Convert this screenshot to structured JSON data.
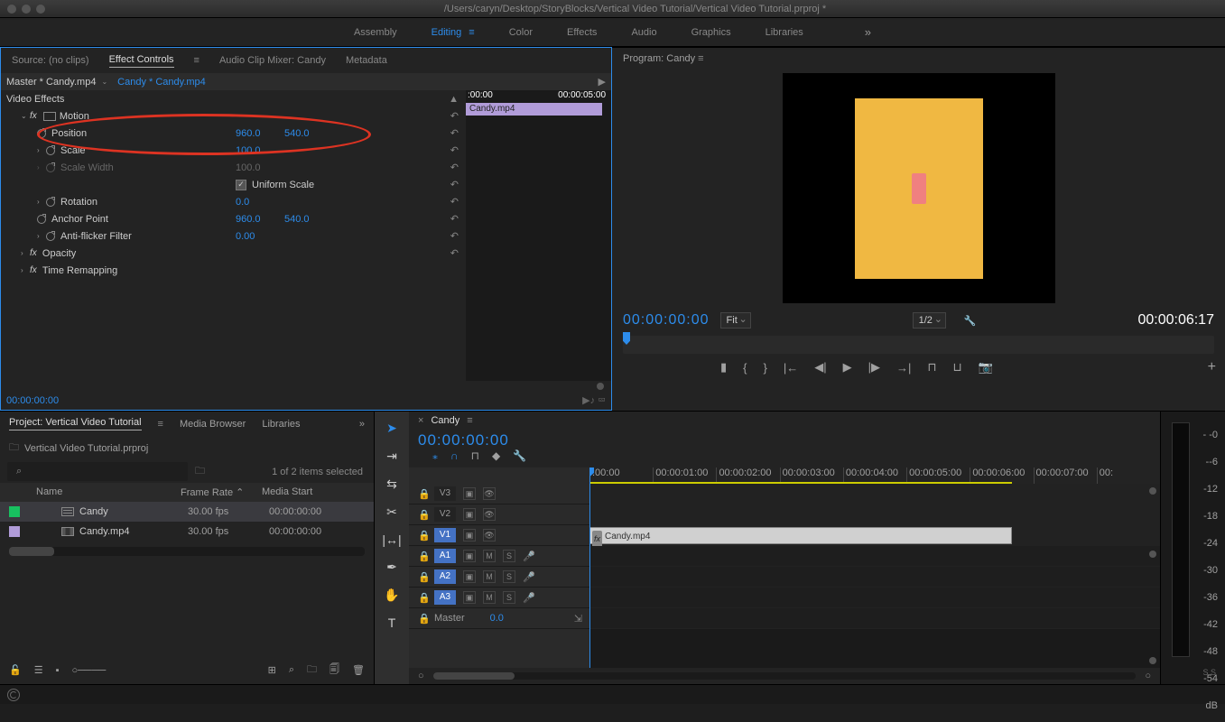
{
  "title": "/Users/caryn/Desktop/StoryBlocks/Vertical Video Tutorial/Vertical Video Tutorial.prproj *",
  "workspaces": [
    "Assembly",
    "Editing",
    "Color",
    "Effects",
    "Audio",
    "Graphics",
    "Libraries"
  ],
  "ws_active": "Editing",
  "source_tabs": [
    "Source: (no clips)",
    "Effect Controls",
    "Audio Clip Mixer: Candy",
    "Metadata"
  ],
  "master": "Master * Candy.mp4",
  "clip_target": "Candy * Candy.mp4",
  "ec_tc_start": ":00:00",
  "ec_tc_end": "00:00:05:00",
  "ec_clip": "Candy.mp4",
  "video_effects_label": "Video Effects",
  "motion": {
    "label": "Motion",
    "position_label": "Position",
    "position_x": "960.0",
    "position_y": "540.0",
    "scale_label": "Scale",
    "scale": "100.0",
    "scale_w_label": "Scale Width",
    "scale_w": "100.0",
    "uniform_label": "Uniform Scale",
    "rotation_label": "Rotation",
    "rotation": "0.0",
    "anchor_label": "Anchor Point",
    "anchor_x": "960.0",
    "anchor_y": "540.0",
    "flicker_label": "Anti-flicker Filter",
    "flicker": "0.00"
  },
  "opacity_label": "Opacity",
  "timeremap_label": "Time Remapping",
  "ec_foot_tc": "00:00:00:00",
  "program": {
    "title": "Program: Candy",
    "tc_in": "00:00:00:00",
    "fit": "Fit",
    "res": "1/2",
    "tc_out": "00:00:06:17"
  },
  "project": {
    "tabs": [
      "Project: Vertical Video Tutorial",
      "Media Browser",
      "Libraries"
    ],
    "bin": "Vertical Video Tutorial.prproj",
    "items_text": "1 of 2 items selected",
    "cols": {
      "name": "Name",
      "frame": "Frame Rate",
      "media": "Media Start"
    },
    "rows": [
      {
        "swatch": "#18c060",
        "type": "seq",
        "name": "Candy",
        "fps": "30.00 fps",
        "start": "00:00:00:00",
        "sel": true
      },
      {
        "swatch": "#b19cd9",
        "type": "clip",
        "name": "Candy.mp4",
        "fps": "30.00 fps",
        "start": "00:00:00:00",
        "sel": false
      }
    ]
  },
  "timeline": {
    "name": "Candy",
    "tc": "00:00:00:00",
    "ruler": [
      ":00:00",
      "00:00:01:00",
      "00:00:02:00",
      "00:00:03:00",
      "00:00:04:00",
      "00:00:05:00",
      "00:00:06:00",
      "00:00:07:00",
      "00:"
    ],
    "tracks_v": [
      {
        "name": "V3",
        "on": false
      },
      {
        "name": "V2",
        "on": false
      },
      {
        "name": "V1",
        "on": true
      }
    ],
    "tracks_a": [
      {
        "name": "A1",
        "on": true
      },
      {
        "name": "A2",
        "on": true
      },
      {
        "name": "A3",
        "on": true
      }
    ],
    "master_label": "Master",
    "master_val": "0.0",
    "clip_name": "Candy.mp4"
  },
  "meter": {
    "ticks": [
      "- -0",
      "--6",
      "-12",
      "-18",
      "-24",
      "-30",
      "-36",
      "-42",
      "-48",
      "-54",
      "dB"
    ],
    "label": "S S"
  }
}
